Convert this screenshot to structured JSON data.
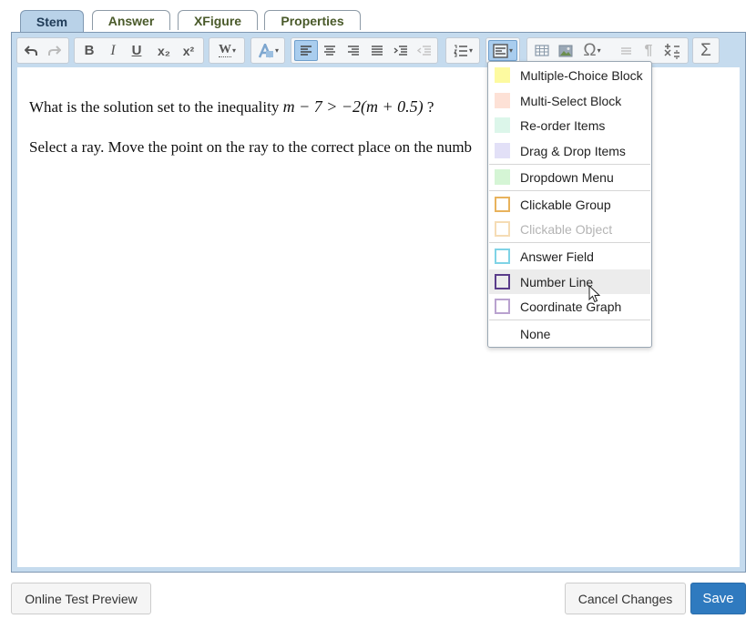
{
  "tabs": [
    {
      "label": "Stem",
      "active": true
    },
    {
      "label": "Answer",
      "active": false
    },
    {
      "label": "XFigure",
      "active": false
    },
    {
      "label": "Properties",
      "active": false
    }
  ],
  "toolbar": {
    "bold": "B",
    "italic": "I",
    "underline": "U",
    "subscript": "x₂",
    "superscript": "x²",
    "word": "W",
    "special_char": "Ω",
    "formula": "Σ",
    "pilcrow": "¶",
    "active_alignment": "align-left",
    "caret": "▾"
  },
  "question": {
    "line1_prefix": "What is the solution set to the inequality",
    "line1_math": "m − 7 > −2(m + 0.5)",
    "line1_suffix": "?",
    "line2": "Select a ray. Move the point on the ray to the correct place on the numb"
  },
  "insert_menu": {
    "items": [
      {
        "label": "Multiple-Choice Block",
        "swatch_color": "#fdfaa0",
        "swatch_style": "fill",
        "disabled": false
      },
      {
        "label": "Multi-Select Block",
        "swatch_color": "#fde1d6",
        "swatch_style": "fill",
        "disabled": false
      },
      {
        "label": "Re-order Items",
        "swatch_color": "#dcf6ea",
        "swatch_style": "fill",
        "disabled": false
      },
      {
        "label": "Drag & Drop Items",
        "swatch_color": "#e2e0f7",
        "swatch_style": "fill",
        "disabled": false
      },
      {
        "label": "Dropdown Menu",
        "swatch_color": "#d5f5d5",
        "swatch_style": "fill",
        "disabled": false
      },
      {
        "label": "Clickable Group",
        "swatch_color": "#e8b25c",
        "swatch_style": "outline",
        "disabled": false
      },
      {
        "label": "Clickable Object",
        "swatch_color": "#f5dcb5",
        "swatch_style": "outline",
        "disabled": true
      },
      {
        "label": "Answer Field",
        "swatch_color": "#7fd3e6",
        "swatch_style": "outline",
        "disabled": false
      },
      {
        "label": "Number Line",
        "swatch_color": "#5a3c8a",
        "swatch_style": "outline",
        "disabled": false,
        "hovered": true
      },
      {
        "label": "Coordinate Graph",
        "swatch_color": "#b9a2cf",
        "swatch_style": "outline",
        "disabled": false
      },
      {
        "label": "None",
        "swatch_color": "",
        "swatch_style": "none",
        "disabled": false
      }
    ]
  },
  "footer": {
    "preview_label": "Online Test Preview",
    "cancel_label": "Cancel Changes",
    "save_label": "Save"
  },
  "colors": {
    "editor_frame": "#c5dbee",
    "primary_button": "#2f7abf",
    "active_tab": "#b9d2e8"
  }
}
